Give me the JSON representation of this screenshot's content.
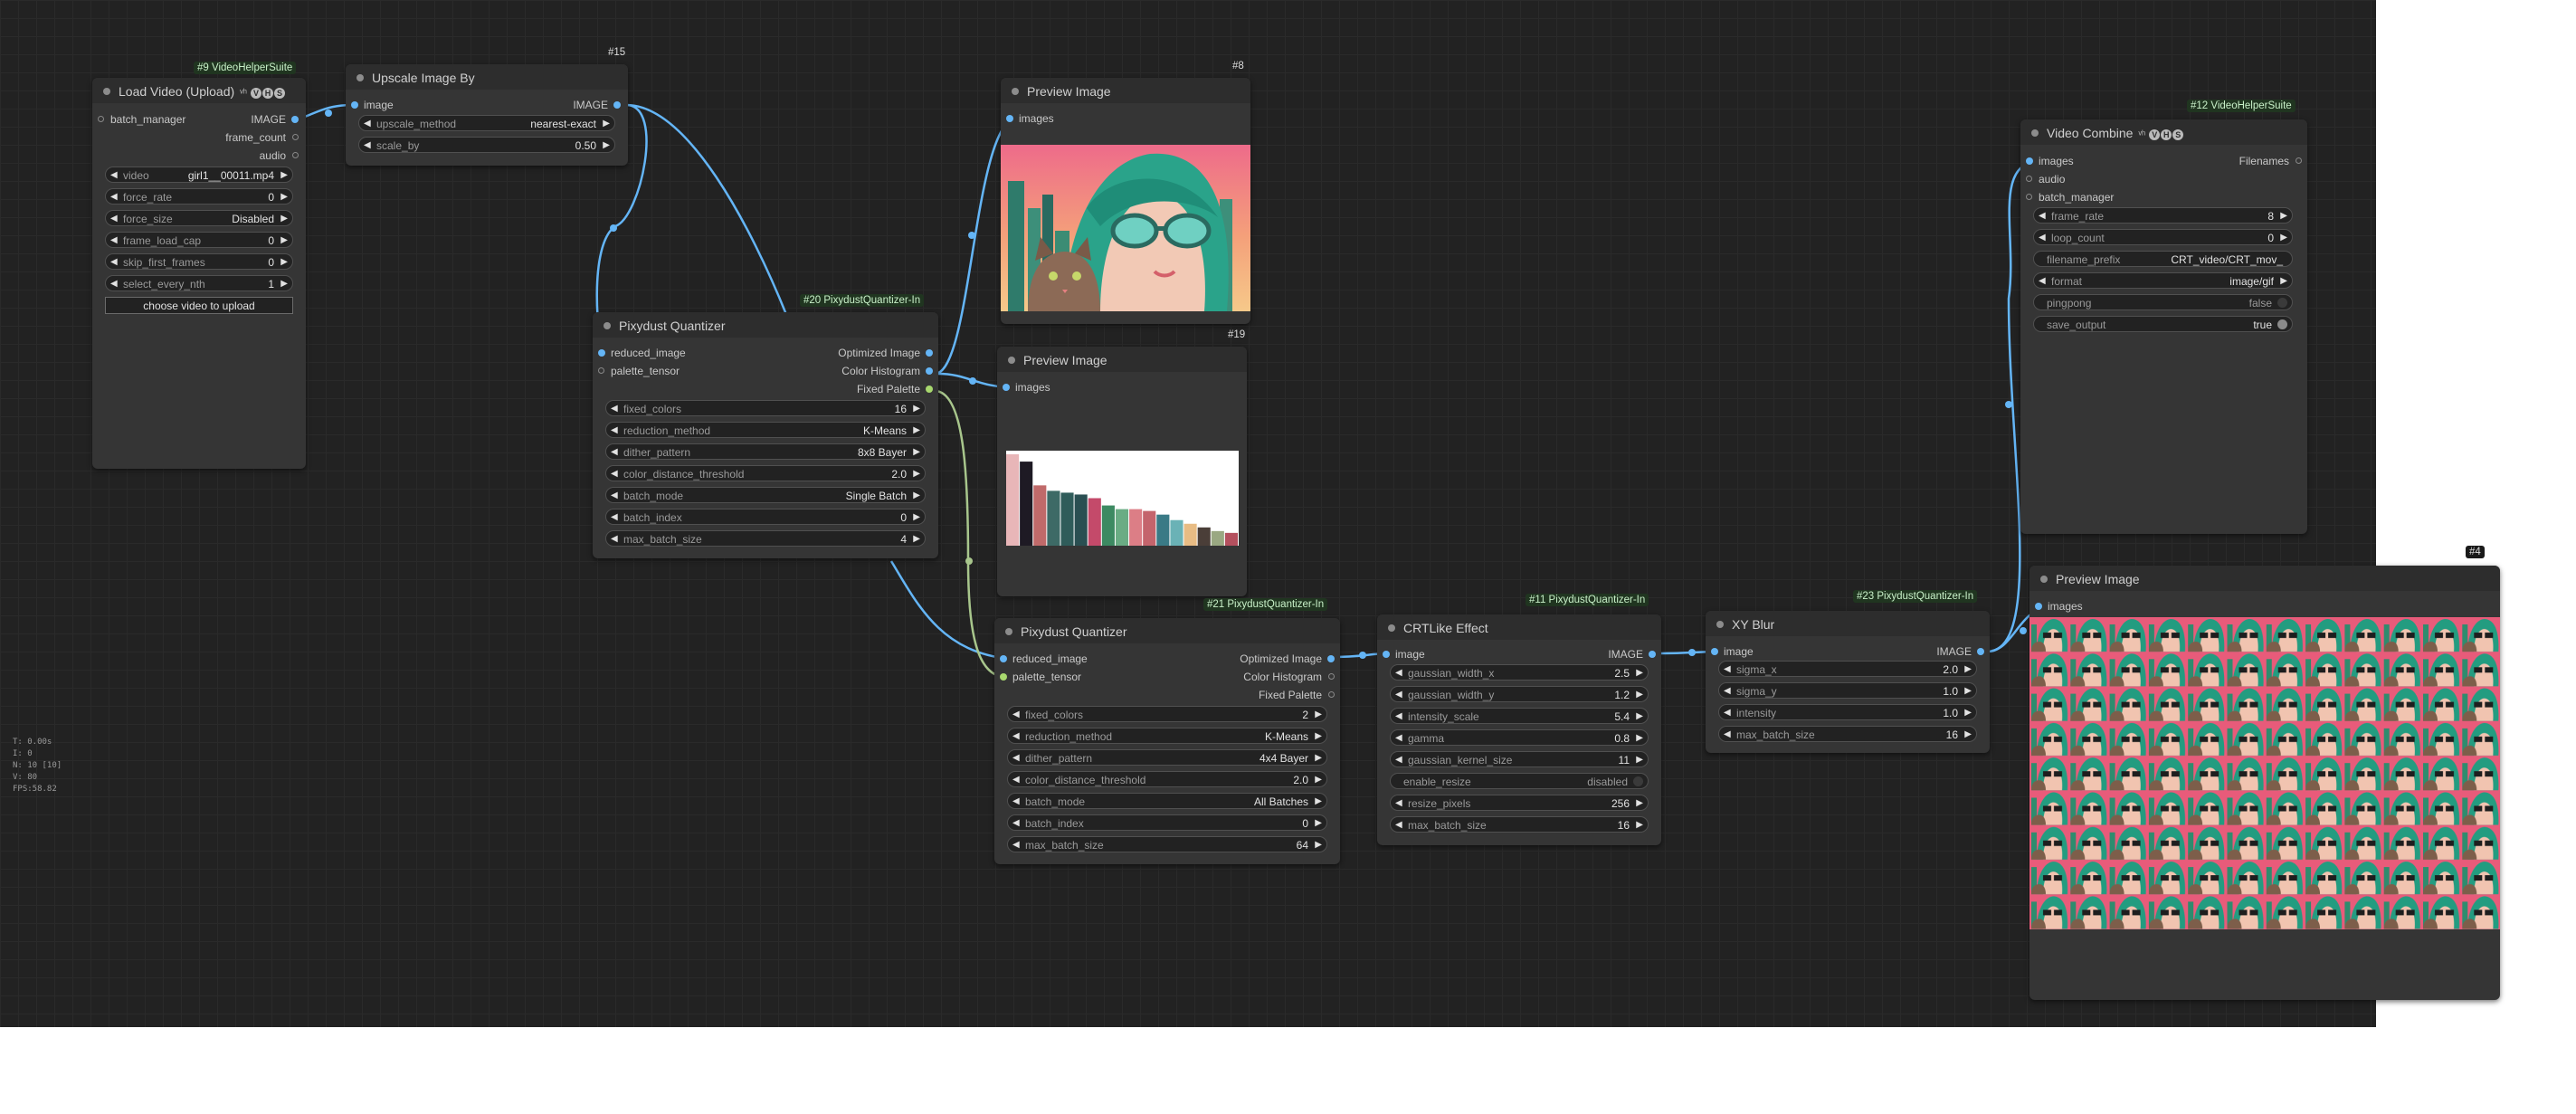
{
  "nodes": {
    "load_video": {
      "id": "#9 VideoHelperSuite",
      "title": "Load Video (Upload)",
      "inputs": [
        "batch_manager"
      ],
      "outputs": [
        "IMAGE",
        "frame_count",
        "audio"
      ],
      "widgets": [
        {
          "label": "video",
          "value": "girl1__00011.mp4"
        },
        {
          "label": "force_rate",
          "value": "0"
        },
        {
          "label": "force_size",
          "value": "Disabled"
        },
        {
          "label": "frame_load_cap",
          "value": "0"
        },
        {
          "label": "skip_first_frames",
          "value": "0"
        },
        {
          "label": "select_every_nth",
          "value": "1"
        }
      ],
      "button": "choose video to upload"
    },
    "upscale": {
      "id": "#15",
      "title": "Upscale Image By",
      "input": "image",
      "output": "IMAGE",
      "widgets": [
        {
          "label": "upscale_method",
          "value": "nearest-exact"
        },
        {
          "label": "scale_by",
          "value": "0.50"
        }
      ]
    },
    "preview8": {
      "id": "#8",
      "title": "Preview Image",
      "input": "images"
    },
    "preview19": {
      "id": "#19",
      "title": "Preview Image",
      "input": "images"
    },
    "pq20": {
      "id": "#20 PixydustQuantizer-In",
      "title": "Pixydust Quantizer",
      "inputs": [
        "reduced_image",
        "palette_tensor"
      ],
      "outputs": [
        "Optimized Image",
        "Color Histogram",
        "Fixed Palette"
      ],
      "widgets": [
        {
          "label": "fixed_colors",
          "value": "16"
        },
        {
          "label": "reduction_method",
          "value": "K-Means"
        },
        {
          "label": "dither_pattern",
          "value": "8x8 Bayer"
        },
        {
          "label": "color_distance_threshold",
          "value": "2.0"
        },
        {
          "label": "batch_mode",
          "value": "Single Batch"
        },
        {
          "label": "batch_index",
          "value": "0"
        },
        {
          "label": "max_batch_size",
          "value": "4"
        }
      ]
    },
    "pq21": {
      "id": "#21 PixydustQuantizer-In",
      "title": "Pixydust Quantizer",
      "inputs": [
        "reduced_image",
        "palette_tensor"
      ],
      "outputs": [
        "Optimized Image",
        "Color Histogram",
        "Fixed Palette"
      ],
      "widgets": [
        {
          "label": "fixed_colors",
          "value": "2"
        },
        {
          "label": "reduction_method",
          "value": "K-Means"
        },
        {
          "label": "dither_pattern",
          "value": "4x4 Bayer"
        },
        {
          "label": "color_distance_threshold",
          "value": "2.0"
        },
        {
          "label": "batch_mode",
          "value": "All Batches"
        },
        {
          "label": "batch_index",
          "value": "0"
        },
        {
          "label": "max_batch_size",
          "value": "64"
        }
      ]
    },
    "crt": {
      "id": "#11 PixydustQuantizer-In",
      "title": "CRTLike Effect",
      "input": "image",
      "output": "IMAGE",
      "widgets": [
        {
          "label": "gaussian_width_x",
          "value": "2.5"
        },
        {
          "label": "gaussian_width_y",
          "value": "1.2"
        },
        {
          "label": "intensity_scale",
          "value": "5.4"
        },
        {
          "label": "gamma",
          "value": "0.8"
        },
        {
          "label": "gaussian_kernel_size",
          "value": "11"
        }
      ],
      "toggle": {
        "label": "enable_resize",
        "value": "disabled"
      },
      "widgets2": [
        {
          "label": "resize_pixels",
          "value": "256"
        },
        {
          "label": "max_batch_size",
          "value": "16"
        }
      ]
    },
    "xyblur": {
      "id": "#23 PixydustQuantizer-In",
      "title": "XY Blur",
      "input": "image",
      "output": "IMAGE",
      "widgets": [
        {
          "label": "sigma_x",
          "value": "2.0"
        },
        {
          "label": "sigma_y",
          "value": "1.0"
        },
        {
          "label": "intensity",
          "value": "1.0"
        },
        {
          "label": "max_batch_size",
          "value": "16"
        }
      ]
    },
    "combine": {
      "id": "#12 VideoHelperSuite",
      "title": "Video Combine",
      "inputs": [
        "images",
        "audio",
        "batch_manager"
      ],
      "output": "Filenames",
      "widgets": [
        {
          "label": "frame_rate",
          "value": "8"
        },
        {
          "label": "loop_count",
          "value": "0"
        }
      ],
      "prefix": {
        "label": "filename_prefix",
        "value": "CRT_video/CRT_mov_"
      },
      "format": {
        "label": "format",
        "value": "image/gif"
      },
      "toggles": [
        {
          "label": "pingpong",
          "value": "false",
          "on": false
        },
        {
          "label": "save_output",
          "value": "true",
          "on": true
        }
      ]
    },
    "preview4": {
      "id": "#4",
      "title": "Preview Image",
      "input": "images"
    }
  },
  "badge_icons": [
    "VHS-badge-icon"
  ],
  "histogram": {
    "bar_colors": [
      "#e8b6b8",
      "#1e1a24",
      "#c06a6a",
      "#3d6a66",
      "#2f5c5a",
      "#2a4f52",
      "#c44a6a",
      "#3d8a62",
      "#6aac84",
      "#dc7e86",
      "#c4646c",
      "#3a7a86",
      "#6ab2b6",
      "#e8bc84",
      "#4a3e38",
      "#9aa882",
      "#b4505e"
    ],
    "values": [
      100,
      92,
      66,
      60,
      58,
      56,
      52,
      44,
      40,
      40,
      38,
      34,
      28,
      24,
      20,
      16,
      14
    ]
  },
  "perf": [
    "T: 0.00s",
    "I: 0",
    "N: 10 [10]",
    "V: 80",
    "FPS:58.82"
  ],
  "colors": {
    "link": "#64b5f6",
    "link_green": "#a8c68c",
    "canvas": "#222222",
    "node": "#353535"
  }
}
